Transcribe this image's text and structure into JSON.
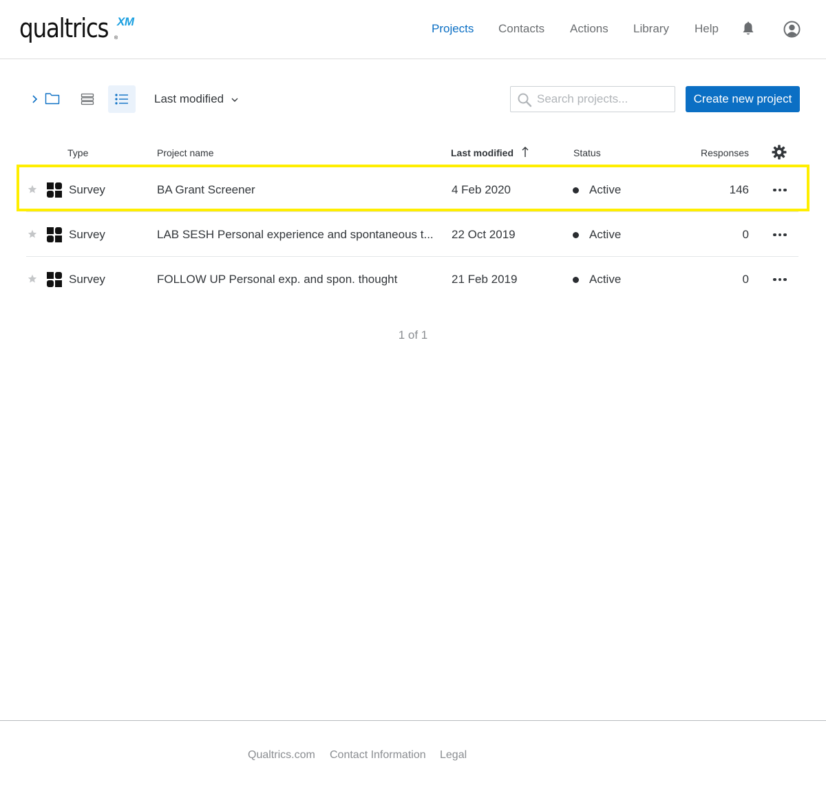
{
  "brand": {
    "name": "qualtrics",
    "suffix": "XM",
    "registered": "®"
  },
  "nav": {
    "items": [
      {
        "label": "Projects",
        "active": true
      },
      {
        "label": "Contacts",
        "active": false
      },
      {
        "label": "Actions",
        "active": false
      },
      {
        "label": "Library",
        "active": false
      },
      {
        "label": "Help",
        "active": false
      }
    ],
    "icons": [
      "bell-icon",
      "user-account-icon"
    ]
  },
  "toolbar": {
    "sort_label": "Last modified",
    "search_placeholder": "Search projects...",
    "create_label": "Create new project",
    "views": [
      "folders",
      "compact-list",
      "detailed-list"
    ],
    "selected_view": "detailed-list"
  },
  "table": {
    "columns": {
      "type": "Type",
      "name": "Project name",
      "modified": "Last modified",
      "status": "Status",
      "responses": "Responses"
    },
    "sort": {
      "column": "Last modified",
      "direction": "ascending-arrow"
    },
    "rows": [
      {
        "type": "Survey",
        "name": "BA Grant Screener",
        "modified": "4 Feb 2020",
        "status": "Active",
        "responses": "146",
        "highlighted": true
      },
      {
        "type": "Survey",
        "name": "LAB SESH Personal experience and spontaneous t...",
        "modified": "22 Oct 2019",
        "status": "Active",
        "responses": "0",
        "highlighted": false
      },
      {
        "type": "Survey",
        "name": "FOLLOW UP Personal exp. and spon. thought",
        "modified": "21 Feb 2019",
        "status": "Active",
        "responses": "0",
        "highlighted": false
      }
    ]
  },
  "pager": {
    "text": "1 of 1"
  },
  "footer": {
    "links": [
      "Qualtrics.com",
      "Contact Information",
      "Legal"
    ]
  },
  "colors": {
    "accent": "#0b6fc4",
    "highlight": "#ffee00",
    "logo_xm": "#1a9fe0"
  }
}
